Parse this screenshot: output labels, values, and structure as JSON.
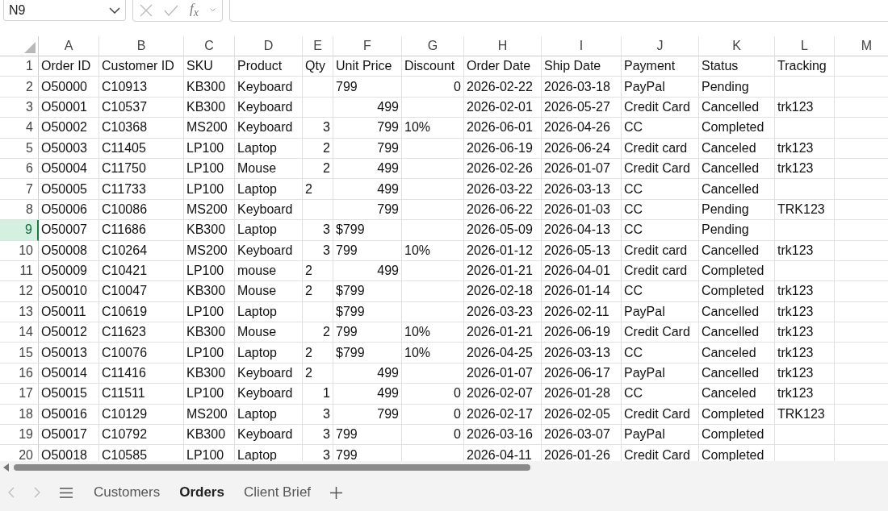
{
  "name_box": {
    "value": "N9"
  },
  "formula_bar": {
    "function_label": "f$_{x}$"
  },
  "columns": [
    {
      "letter": "A",
      "selected": false
    },
    {
      "letter": "B",
      "selected": false
    },
    {
      "letter": "C",
      "selected": false
    },
    {
      "letter": "D",
      "selected": false
    },
    {
      "letter": "E",
      "selected": false
    },
    {
      "letter": "F",
      "selected": false
    },
    {
      "letter": "G",
      "selected": false
    },
    {
      "letter": "H",
      "selected": false
    },
    {
      "letter": "I",
      "selected": false
    },
    {
      "letter": "J",
      "selected": false
    },
    {
      "letter": "K",
      "selected": false
    },
    {
      "letter": "L",
      "selected": false
    },
    {
      "letter": "M",
      "selected": false
    }
  ],
  "rows": [
    {
      "number": "1",
      "selected": false,
      "cells": [
        {
          "text": "Order ID",
          "kind": "text"
        },
        {
          "text": "Customer ID",
          "kind": "text"
        },
        {
          "text": "SKU",
          "kind": "text"
        },
        {
          "text": "Product",
          "kind": "text"
        },
        {
          "text": "Qty",
          "kind": "text"
        },
        {
          "text": "Unit Price",
          "kind": "text"
        },
        {
          "text": "Discount",
          "kind": "text"
        },
        {
          "text": "Order Date",
          "kind": "text"
        },
        {
          "text": "Ship Date",
          "kind": "text"
        },
        {
          "text": "Payment",
          "kind": "text"
        },
        {
          "text": "Status",
          "kind": "text"
        },
        {
          "text": "Tracking",
          "kind": "text"
        }
      ]
    },
    {
      "number": "2",
      "selected": false,
      "cells": [
        {
          "text": "O50000",
          "kind": "text"
        },
        {
          "text": "C10913",
          "kind": "text"
        },
        {
          "text": "KB300",
          "kind": "text"
        },
        {
          "text": "Keyboard",
          "kind": "text"
        },
        null,
        {
          "text": "799",
          "kind": "text"
        },
        {
          "text": "0",
          "kind": "number"
        },
        {
          "text": "2026-02-22",
          "kind": "text"
        },
        {
          "text": "2026-03-18",
          "kind": "text"
        },
        {
          "text": "PayPal",
          "kind": "text"
        },
        {
          "text": "Pending",
          "kind": "text"
        },
        null
      ]
    },
    {
      "number": "3",
      "selected": false,
      "cells": [
        {
          "text": "O50001",
          "kind": "text"
        },
        {
          "text": "C10537",
          "kind": "text"
        },
        {
          "text": "KB300",
          "kind": "text"
        },
        {
          "text": "Keyboard",
          "kind": "text"
        },
        null,
        {
          "text": "499",
          "kind": "number"
        },
        null,
        {
          "text": "2026-02-01",
          "kind": "text"
        },
        {
          "text": "2026-05-27",
          "kind": "text"
        },
        {
          "text": "Credit Card",
          "kind": "text"
        },
        {
          "text": "Cancelled",
          "kind": "text"
        },
        {
          "text": "trk123",
          "kind": "text"
        }
      ]
    },
    {
      "number": "4",
      "selected": false,
      "cells": [
        {
          "text": "O50002",
          "kind": "text"
        },
        {
          "text": "C10368",
          "kind": "text"
        },
        {
          "text": "MS200",
          "kind": "text"
        },
        {
          "text": "Keyboard",
          "kind": "text"
        },
        {
          "text": "3",
          "kind": "number"
        },
        {
          "text": "799",
          "kind": "number"
        },
        {
          "text": "10%",
          "kind": "text"
        },
        {
          "text": "2026-06-01",
          "kind": "text"
        },
        {
          "text": "2026-04-26",
          "kind": "text"
        },
        {
          "text": "CC",
          "kind": "text"
        },
        {
          "text": "Completed",
          "kind": "text"
        },
        null
      ]
    },
    {
      "number": "5",
      "selected": false,
      "cells": [
        {
          "text": "O50003",
          "kind": "text"
        },
        {
          "text": "C11405",
          "kind": "text"
        },
        {
          "text": "LP100",
          "kind": "text"
        },
        {
          "text": "Laptop",
          "kind": "text"
        },
        {
          "text": "2",
          "kind": "number"
        },
        {
          "text": "799",
          "kind": "number"
        },
        null,
        {
          "text": "2026-06-19",
          "kind": "text"
        },
        {
          "text": "2026-06-24",
          "kind": "text"
        },
        {
          "text": "Credit card",
          "kind": "text"
        },
        {
          "text": "Canceled",
          "kind": "text"
        },
        {
          "text": "trk123",
          "kind": "text"
        }
      ]
    },
    {
      "number": "6",
      "selected": false,
      "cells": [
        {
          "text": "O50004",
          "kind": "text"
        },
        {
          "text": "C11750",
          "kind": "text"
        },
        {
          "text": "LP100",
          "kind": "text"
        },
        {
          "text": "Mouse",
          "kind": "text"
        },
        {
          "text": "2",
          "kind": "number"
        },
        {
          "text": "499",
          "kind": "number"
        },
        null,
        {
          "text": "2026-02-26",
          "kind": "text"
        },
        {
          "text": "2026-01-07",
          "kind": "text"
        },
        {
          "text": "Credit Card",
          "kind": "text"
        },
        {
          "text": "Cancelled",
          "kind": "text"
        },
        {
          "text": "trk123",
          "kind": "text"
        }
      ]
    },
    {
      "number": "7",
      "selected": false,
      "cells": [
        {
          "text": "O50005",
          "kind": "text"
        },
        {
          "text": "C11733",
          "kind": "text"
        },
        {
          "text": "LP100",
          "kind": "text"
        },
        {
          "text": "Laptop",
          "kind": "text"
        },
        {
          "text": "2",
          "kind": "text"
        },
        {
          "text": "499",
          "kind": "number"
        },
        null,
        {
          "text": "2026-03-22",
          "kind": "text"
        },
        {
          "text": "2026-03-13",
          "kind": "text"
        },
        {
          "text": "CC",
          "kind": "text"
        },
        {
          "text": "Cancelled",
          "kind": "text"
        },
        null
      ]
    },
    {
      "number": "8",
      "selected": false,
      "cells": [
        {
          "text": "O50006",
          "kind": "text"
        },
        {
          "text": "C10086",
          "kind": "text"
        },
        {
          "text": "MS200",
          "kind": "text"
        },
        {
          "text": "Keyboard",
          "kind": "text"
        },
        null,
        {
          "text": "799",
          "kind": "number"
        },
        null,
        {
          "text": "2026-06-22",
          "kind": "text"
        },
        {
          "text": "2026-01-03",
          "kind": "text"
        },
        {
          "text": "CC",
          "kind": "text"
        },
        {
          "text": "Pending",
          "kind": "text"
        },
        {
          "text": "TRK123",
          "kind": "text"
        }
      ]
    },
    {
      "number": "9",
      "selected": true,
      "cells": [
        {
          "text": "O50007",
          "kind": "text"
        },
        {
          "text": "C11686",
          "kind": "text"
        },
        {
          "text": "KB300",
          "kind": "text"
        },
        {
          "text": "Laptop",
          "kind": "text"
        },
        {
          "text": "3",
          "kind": "number"
        },
        {
          "text": "$799",
          "kind": "text"
        },
        null,
        {
          "text": "2026-05-09",
          "kind": "text"
        },
        {
          "text": "2026-04-13",
          "kind": "text"
        },
        {
          "text": "CC",
          "kind": "text"
        },
        {
          "text": "Pending",
          "kind": "text"
        },
        null
      ]
    },
    {
      "number": "10",
      "selected": false,
      "cells": [
        {
          "text": "O50008",
          "kind": "text"
        },
        {
          "text": "C10264",
          "kind": "text"
        },
        {
          "text": "MS200",
          "kind": "text"
        },
        {
          "text": "Keyboard",
          "kind": "text"
        },
        {
          "text": "3",
          "kind": "number"
        },
        {
          "text": "799",
          "kind": "text"
        },
        {
          "text": "10%",
          "kind": "text"
        },
        {
          "text": "2026-01-12",
          "kind": "text"
        },
        {
          "text": "2026-05-13",
          "kind": "text"
        },
        {
          "text": "Credit card",
          "kind": "text"
        },
        {
          "text": "Cancelled",
          "kind": "text"
        },
        {
          "text": "trk123",
          "kind": "text"
        }
      ]
    },
    {
      "number": "11",
      "selected": false,
      "cells": [
        {
          "text": "O50009",
          "kind": "text"
        },
        {
          "text": "C10421",
          "kind": "text"
        },
        {
          "text": "LP100",
          "kind": "text"
        },
        {
          "text": "mouse",
          "kind": "text"
        },
        {
          "text": "2",
          "kind": "text"
        },
        {
          "text": "499",
          "kind": "number"
        },
        null,
        {
          "text": "2026-01-21",
          "kind": "text"
        },
        {
          "text": "2026-04-01",
          "kind": "text"
        },
        {
          "text": "Credit card",
          "kind": "text"
        },
        {
          "text": "Completed",
          "kind": "text"
        },
        null
      ]
    },
    {
      "number": "12",
      "selected": false,
      "cells": [
        {
          "text": "O50010",
          "kind": "text"
        },
        {
          "text": "C10047",
          "kind": "text"
        },
        {
          "text": "KB300",
          "kind": "text"
        },
        {
          "text": "Mouse",
          "kind": "text"
        },
        {
          "text": "2",
          "kind": "text"
        },
        {
          "text": "$799",
          "kind": "text"
        },
        null,
        {
          "text": "2026-02-18",
          "kind": "text"
        },
        {
          "text": "2026-01-14",
          "kind": "text"
        },
        {
          "text": "CC",
          "kind": "text"
        },
        {
          "text": "Completed",
          "kind": "text"
        },
        {
          "text": "trk123",
          "kind": "text"
        }
      ]
    },
    {
      "number": "13",
      "selected": false,
      "cells": [
        {
          "text": "O50011",
          "kind": "text"
        },
        {
          "text": "C10619",
          "kind": "text"
        },
        {
          "text": "LP100",
          "kind": "text"
        },
        {
          "text": "Laptop",
          "kind": "text"
        },
        null,
        {
          "text": "$799",
          "kind": "text"
        },
        null,
        {
          "text": "2026-03-23",
          "kind": "text"
        },
        {
          "text": "2026-02-11",
          "kind": "text"
        },
        {
          "text": "PayPal",
          "kind": "text"
        },
        {
          "text": "Cancelled",
          "kind": "text"
        },
        {
          "text": "trk123",
          "kind": "text"
        }
      ]
    },
    {
      "number": "14",
      "selected": false,
      "cells": [
        {
          "text": "O50012",
          "kind": "text"
        },
        {
          "text": "C11623",
          "kind": "text"
        },
        {
          "text": "KB300",
          "kind": "text"
        },
        {
          "text": "Mouse",
          "kind": "text"
        },
        {
          "text": "2",
          "kind": "number"
        },
        {
          "text": "799",
          "kind": "text"
        },
        {
          "text": "10%",
          "kind": "text"
        },
        {
          "text": "2026-01-21",
          "kind": "text"
        },
        {
          "text": "2026-06-19",
          "kind": "text"
        },
        {
          "text": "Credit Card",
          "kind": "text"
        },
        {
          "text": "Cancelled",
          "kind": "text"
        },
        {
          "text": "trk123",
          "kind": "text"
        }
      ]
    },
    {
      "number": "15",
      "selected": false,
      "cells": [
        {
          "text": "O50013",
          "kind": "text"
        },
        {
          "text": "C10076",
          "kind": "text"
        },
        {
          "text": "LP100",
          "kind": "text"
        },
        {
          "text": "Laptop",
          "kind": "text"
        },
        {
          "text": "2",
          "kind": "text"
        },
        {
          "text": "$799",
          "kind": "text"
        },
        {
          "text": "10%",
          "kind": "text"
        },
        {
          "text": "2026-04-25",
          "kind": "text"
        },
        {
          "text": "2026-03-13",
          "kind": "text"
        },
        {
          "text": "CC",
          "kind": "text"
        },
        {
          "text": "Canceled",
          "kind": "text"
        },
        {
          "text": "trk123",
          "kind": "text"
        }
      ]
    },
    {
      "number": "16",
      "selected": false,
      "cells": [
        {
          "text": "O50014",
          "kind": "text"
        },
        {
          "text": "C11416",
          "kind": "text"
        },
        {
          "text": "KB300",
          "kind": "text"
        },
        {
          "text": "Keyboard",
          "kind": "text"
        },
        {
          "text": "2",
          "kind": "text"
        },
        {
          "text": "499",
          "kind": "number"
        },
        null,
        {
          "text": "2026-01-07",
          "kind": "text"
        },
        {
          "text": "2026-06-17",
          "kind": "text"
        },
        {
          "text": "PayPal",
          "kind": "text"
        },
        {
          "text": "Cancelled",
          "kind": "text"
        },
        {
          "text": "trk123",
          "kind": "text"
        }
      ]
    },
    {
      "number": "17",
      "selected": false,
      "cells": [
        {
          "text": "O50015",
          "kind": "text"
        },
        {
          "text": "C11511",
          "kind": "text"
        },
        {
          "text": "LP100",
          "kind": "text"
        },
        {
          "text": "Keyboard",
          "kind": "text"
        },
        {
          "text": "1",
          "kind": "number"
        },
        {
          "text": "499",
          "kind": "number"
        },
        {
          "text": "0",
          "kind": "number"
        },
        {
          "text": "2026-02-07",
          "kind": "text"
        },
        {
          "text": "2026-01-28",
          "kind": "text"
        },
        {
          "text": "CC",
          "kind": "text"
        },
        {
          "text": "Canceled",
          "kind": "text"
        },
        {
          "text": "trk123",
          "kind": "text"
        }
      ]
    },
    {
      "number": "18",
      "selected": false,
      "cells": [
        {
          "text": "O50016",
          "kind": "text"
        },
        {
          "text": "C10129",
          "kind": "text"
        },
        {
          "text": "MS200",
          "kind": "text"
        },
        {
          "text": "Laptop",
          "kind": "text"
        },
        {
          "text": "3",
          "kind": "number"
        },
        {
          "text": "799",
          "kind": "number"
        },
        {
          "text": "0",
          "kind": "number"
        },
        {
          "text": "2026-02-17",
          "kind": "text"
        },
        {
          "text": "2026-02-05",
          "kind": "text"
        },
        {
          "text": "Credit Card",
          "kind": "text"
        },
        {
          "text": "Completed",
          "kind": "text"
        },
        {
          "text": "TRK123",
          "kind": "text"
        }
      ]
    },
    {
      "number": "19",
      "selected": false,
      "cells": [
        {
          "text": "O50017",
          "kind": "text"
        },
        {
          "text": "C10792",
          "kind": "text"
        },
        {
          "text": "KB300",
          "kind": "text"
        },
        {
          "text": "Keyboard",
          "kind": "text"
        },
        {
          "text": "3",
          "kind": "number"
        },
        {
          "text": "799",
          "kind": "text"
        },
        {
          "text": "0",
          "kind": "number"
        },
        {
          "text": "2026-03-16",
          "kind": "text"
        },
        {
          "text": "2026-03-07",
          "kind": "text"
        },
        {
          "text": "PayPal",
          "kind": "text"
        },
        {
          "text": "Completed",
          "kind": "text"
        },
        null
      ]
    },
    {
      "number": "20",
      "selected": false,
      "cells": [
        {
          "text": "O50018",
          "kind": "text"
        },
        {
          "text": "C10585",
          "kind": "text"
        },
        {
          "text": "LP100",
          "kind": "text"
        },
        {
          "text": "Laptop",
          "kind": "text"
        },
        {
          "text": "3",
          "kind": "number"
        },
        {
          "text": "799",
          "kind": "text"
        },
        null,
        {
          "text": "2026-04-11",
          "kind": "text"
        },
        {
          "text": "2026-01-26",
          "kind": "text"
        },
        {
          "text": "Credit Card",
          "kind": "text"
        },
        {
          "text": "Completed",
          "kind": "text"
        },
        null
      ]
    }
  ],
  "sheet_tabs": [
    {
      "label": "Customers",
      "selected": false
    },
    {
      "label": "Orders",
      "selected": true
    },
    {
      "label": "Client Brief",
      "selected": false
    }
  ]
}
